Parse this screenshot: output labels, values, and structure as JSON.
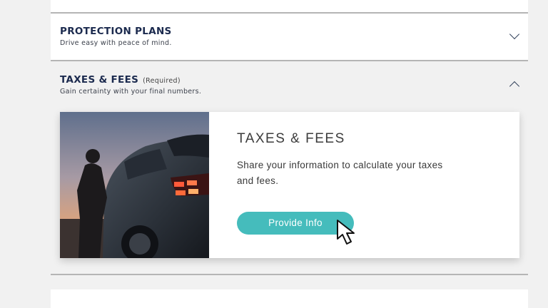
{
  "sections": {
    "protection": {
      "title": "PROTECTION PLANS",
      "subtitle": "Drive easy with peace of mind.",
      "chevron": "chevron-down-icon"
    },
    "taxes": {
      "title": "TAXES & FEES",
      "required": "(Required)",
      "subtitle": "Gain certainty with your final numbers.",
      "chevron": "chevron-up-icon",
      "card": {
        "heading": "TAXES & FEES",
        "description": "Share your information to calculate your taxes and fees.",
        "button_label": "Provide Info",
        "image": "person-beside-electric-suv-at-dusk"
      }
    }
  },
  "colors": {
    "accent": "#45bcbc",
    "title": "#1b2a4e",
    "background": "#f1f1f1"
  }
}
